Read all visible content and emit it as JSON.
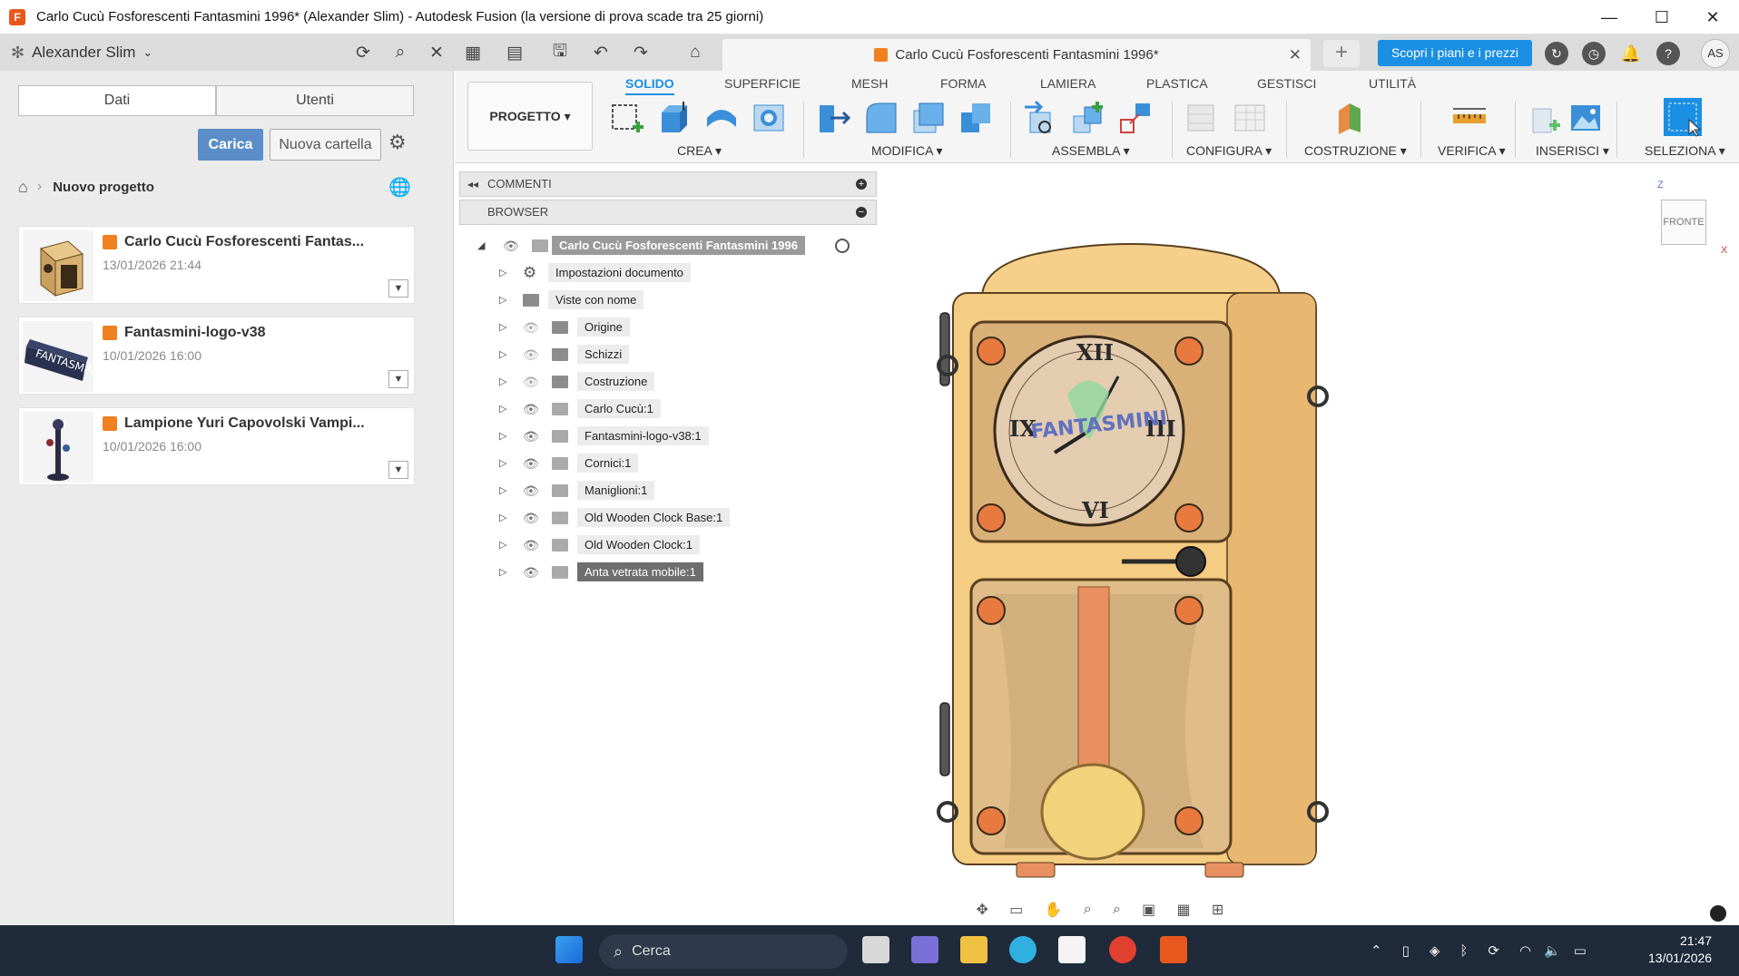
{
  "window": {
    "title": "Carlo Cucù Fosforescenti Fantasmini 1996* (Alexander Slim) - Autodesk Fusion (la versione di prova scade tra 25 giorni)"
  },
  "appbar": {
    "user_name": "Alexander Slim",
    "doc_tab_title": "Carlo Cucù Fosforescenti Fantasmini 1996*",
    "promo_label": "Scopri i piani e i prezzi",
    "avatar_initials": "AS"
  },
  "left_panel": {
    "tabs": [
      "Dati",
      "Utenti"
    ],
    "upload_label": "Carica",
    "new_folder_label": "Nuova cartella",
    "breadcrumb": "Nuovo progetto",
    "projects": [
      {
        "name": "Carlo Cucù Fosforescenti Fantas...",
        "date": "13/01/2026 21:44"
      },
      {
        "name": "Fantasmini-logo-v38",
        "date": "10/01/2026 16:00"
      },
      {
        "name": "Lampione Yuri Capovolski Vampi...",
        "date": "10/01/2026 16:00"
      }
    ]
  },
  "toolbar": {
    "project_button": "PROGETTO",
    "tabs": [
      "SOLIDO",
      "SUPERFICIE",
      "MESH",
      "FORMA",
      "LAMIERA",
      "PLASTICA",
      "GESTISCI",
      "UTILITÀ"
    ],
    "groups": [
      "CREA",
      "MODIFICA",
      "ASSEMBLA",
      "CONFIGURA",
      "COSTRUZIONE",
      "VERIFICA",
      "INSERISCI",
      "SELEZIONA"
    ]
  },
  "browser": {
    "comments_label": "COMMENTI",
    "browser_label": "BROWSER",
    "root": "Carlo Cucù Fosforescenti Fantasmini 1996",
    "items": [
      "Impostazioni documento",
      "Viste con nome",
      "Origine",
      "Schizzi",
      "Costruzione",
      "Carlo Cucù:1",
      "Fantasmini-logo-v38:1",
      "Cornici:1",
      "Maniglioni:1",
      "Old Wooden Clock Base:1",
      "Old Wooden Clock:1",
      "Anta vetrata mobile:1"
    ]
  },
  "viewport": {
    "viewcube_label": "FRONTE",
    "axis_z": "Z",
    "axis_x": "X"
  },
  "taskbar": {
    "search_placeholder": "Cerca",
    "time": "21:47",
    "date": "13/01/2026"
  }
}
